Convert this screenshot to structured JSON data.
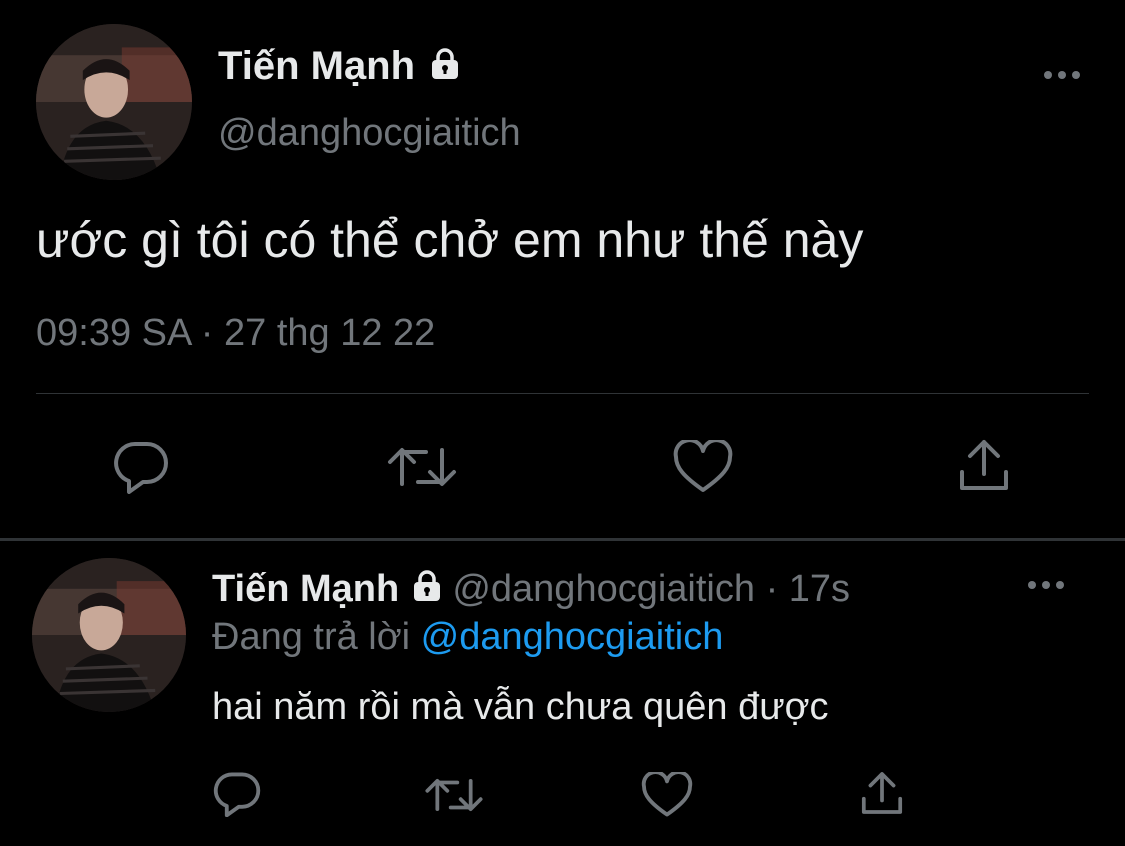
{
  "main_tweet": {
    "author_name": "Tiến Mạnh",
    "author_handle": "@danghocgiaitich",
    "text": "ước gì tôi có thể chở em như thế này",
    "timestamp": "09:39 SA · 27 thg 12 22",
    "icons": [
      "lock-icon",
      "more-icon",
      "reply-icon",
      "retweet-icon",
      "like-icon",
      "share-icon"
    ]
  },
  "reply_tweet": {
    "author_name": "Tiến Mạnh",
    "author_handle": "@danghocgiaitich",
    "age": "· 17s",
    "replying_prefix": "Đang trả lời",
    "replying_to": "@danghocgiaitich",
    "text": "hai năm rồi mà vẫn chưa quên được",
    "icons": [
      "lock-icon",
      "more-icon",
      "reply-icon",
      "retweet-icon",
      "like-icon",
      "share-icon"
    ]
  },
  "colors": {
    "background": "#000000",
    "text": "#e7e9ea",
    "secondary": "#71767b",
    "link": "#1d9bf0",
    "divider": "#2f3336"
  }
}
